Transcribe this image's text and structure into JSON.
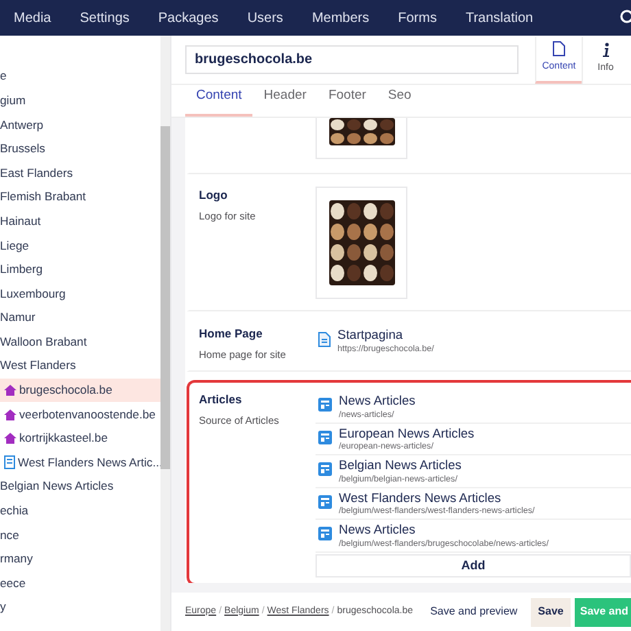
{
  "top_nav": [
    {
      "label": "Media"
    },
    {
      "label": "Settings"
    },
    {
      "label": "Packages"
    },
    {
      "label": "Users"
    },
    {
      "label": "Members"
    },
    {
      "label": "Forms"
    },
    {
      "label": "Translation"
    }
  ],
  "tree": [
    {
      "label": "e",
      "selected": false,
      "children": [
        {
          "label": "gium",
          "selected": false,
          "children": [
            {
              "label": "Antwerp",
              "selected": false
            },
            {
              "label": "Brussels",
              "selected": false
            },
            {
              "label": "East Flanders",
              "selected": false
            },
            {
              "label": "Flemish Brabant",
              "selected": false
            },
            {
              "label": "Hainaut",
              "selected": false
            },
            {
              "label": "Liege",
              "selected": false
            },
            {
              "label": "Limberg",
              "selected": false
            },
            {
              "label": "Luxembourg",
              "selected": false
            },
            {
              "label": "Namur",
              "selected": false
            },
            {
              "label": "Walloon Brabant",
              "selected": false
            },
            {
              "label": "West Flanders",
              "selected": false,
              "children": [
                {
                  "label": "brugeschocola.be",
                  "kind": "site",
                  "selected": true
                },
                {
                  "label": "veerbotenvanoostende.be",
                  "kind": "site",
                  "selected": false
                },
                {
                  "label": "kortrijkkasteel.be",
                  "kind": "site",
                  "selected": false
                },
                {
                  "label": "West Flanders News Artic...",
                  "kind": "list",
                  "selected": false
                }
              ]
            },
            {
              "label": "Belgian News Articles",
              "selected": false
            }
          ]
        },
        {
          "label": "echia",
          "selected": false
        },
        {
          "label": "nce",
          "selected": false
        },
        {
          "label": "rmany",
          "selected": false
        },
        {
          "label": "eece",
          "selected": false
        },
        {
          "label": "y",
          "selected": false
        }
      ]
    }
  ],
  "editor": {
    "name": "brugeschocola.be",
    "apps": [
      {
        "label": "Content",
        "kind": "document",
        "selected": true
      },
      {
        "label": "Info",
        "kind": "info",
        "selected": false
      }
    ],
    "tabs": [
      {
        "label": "Content",
        "selected": true
      },
      {
        "label": "Header",
        "selected": false
      },
      {
        "label": "Footer",
        "selected": false
      },
      {
        "label": "Seo",
        "selected": false
      }
    ],
    "properties": [
      {
        "kind": "image_partial",
        "highlighted": false
      },
      {
        "label": "Logo",
        "description": "Logo for site",
        "highlighted": false
      },
      {
        "kind": "links",
        "label": "Home Page",
        "description": "Home page for site",
        "highlighted": false,
        "items": [
          {
            "kind": "page",
            "title": "Startpagina",
            "url": "https://brugeschocola.be/"
          }
        ]
      },
      {
        "kind": "links",
        "label": "Articles",
        "description": "Source of Articles",
        "highlighted": true,
        "add_label": "Add",
        "items": [
          {
            "kind": "list",
            "title": "News Articles",
            "url": "/news-articles/"
          },
          {
            "kind": "list",
            "title": "European News Articles",
            "url": "/european-news-articles/"
          },
          {
            "kind": "list",
            "title": "Belgian News Articles",
            "url": "/belgium/belgian-news-articles/"
          },
          {
            "kind": "list",
            "title": "West Flanders News Articles",
            "url": "/belgium/west-flanders/west-flanders-news-articles/"
          },
          {
            "kind": "list",
            "title": "News Articles",
            "url": "/belgium/west-flanders/brugeschocolabe/news-articles/"
          }
        ]
      }
    ]
  },
  "footer": {
    "separator": "/",
    "breadcrumbs": [
      {
        "label": "Europe",
        "current": false
      },
      {
        "label": "Belgium",
        "current": false
      },
      {
        "label": "West Flanders",
        "current": false
      },
      {
        "label": "brugeschocola.be",
        "current": true
      }
    ],
    "buttons": [
      {
        "label": "Save and preview",
        "kind": "link"
      },
      {
        "label": "Save",
        "kind": "secondary"
      },
      {
        "label": "Save and",
        "kind": "primary"
      }
    ]
  }
}
